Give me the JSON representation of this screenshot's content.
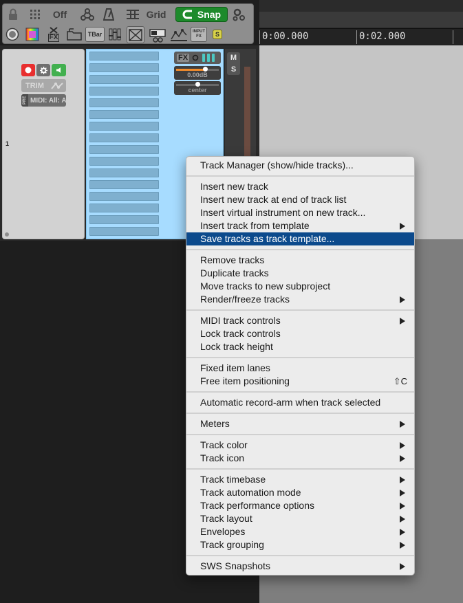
{
  "toolbar": {
    "off_label": "Off",
    "grid_label": "Grid",
    "snap_label": "Snap",
    "tbar_label": "TBar",
    "input_fx_line1": "INPUT",
    "input_fx_line2": "FX",
    "fx_label": "FX",
    "s_label": "S"
  },
  "ruler": {
    "labels": [
      "0:00.000",
      "0:02.000"
    ]
  },
  "track": {
    "number": "1",
    "trim_label": "TRIM",
    "pre_label": "PRE",
    "midi_input": "MIDI: All: A",
    "fx_label": "FX",
    "volume": "0.00dB",
    "volume_fraction": 0.68,
    "pan": "center",
    "pan_fraction": 0.5,
    "mute_label": "M",
    "solo_label": "S"
  },
  "menu": {
    "items": [
      {
        "label": "Track Manager (show/hide tracks)..."
      },
      {
        "label": "Insert new track"
      },
      {
        "label": "Insert new track at end of track list"
      },
      {
        "label": "Insert virtual instrument on new track..."
      },
      {
        "label": "Insert track from template",
        "submenu": true
      },
      {
        "label": "Save tracks as track template...",
        "highlighted": true
      },
      {
        "label": "Remove tracks"
      },
      {
        "label": "Duplicate tracks"
      },
      {
        "label": "Move tracks to new subproject"
      },
      {
        "label": "Render/freeze tracks",
        "submenu": true
      },
      {
        "label": "MIDI track controls",
        "submenu": true
      },
      {
        "label": "Lock track controls"
      },
      {
        "label": "Lock track height"
      },
      {
        "label": "Fixed item lanes"
      },
      {
        "label": "Free item positioning",
        "shortcut": "⇧C"
      },
      {
        "label": "Automatic record-arm when track selected"
      },
      {
        "label": "Meters",
        "submenu": true
      },
      {
        "label": "Track color",
        "submenu": true
      },
      {
        "label": "Track icon",
        "submenu": true
      },
      {
        "label": "Track timebase",
        "submenu": true
      },
      {
        "label": "Track automation mode",
        "submenu": true
      },
      {
        "label": "Track performance options",
        "submenu": true
      },
      {
        "label": "Track layout",
        "submenu": true
      },
      {
        "label": "Envelopes",
        "submenu": true
      },
      {
        "label": "Track grouping",
        "submenu": true
      },
      {
        "label": "SWS Snapshots",
        "submenu": true
      }
    ]
  },
  "colors": {
    "snap_green": "#1d8a2b",
    "menu_highlight": "#0c4a8c",
    "track_selected": "#a7dcff",
    "record_red": "#e82e2e",
    "monitor_green": "#42b04f"
  }
}
